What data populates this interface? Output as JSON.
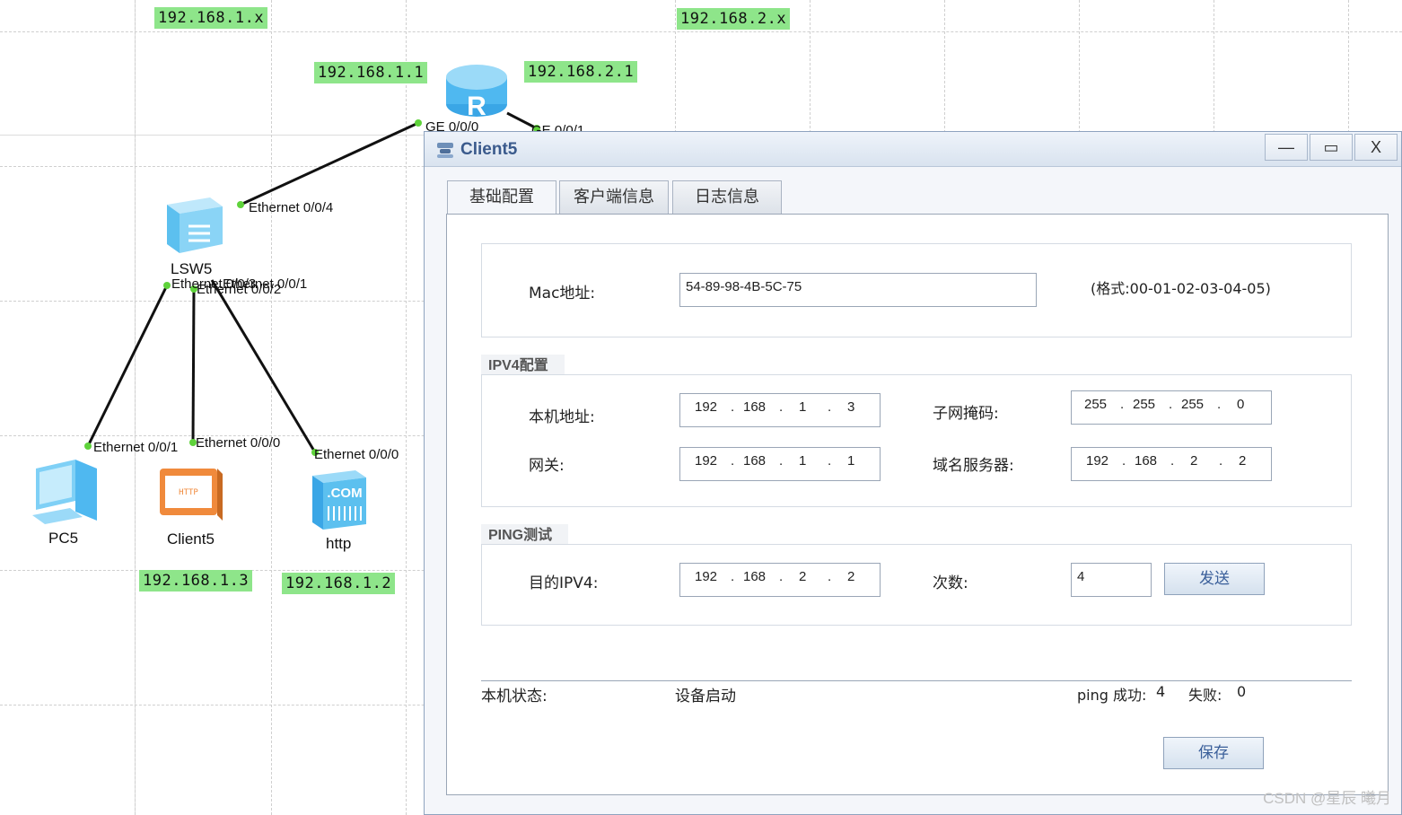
{
  "topology": {
    "subnet_labels": [
      "192.168.1.x",
      "192.168.2.x"
    ],
    "router_ip_left": "192.168.1.1",
    "router_ip_right": "192.168.2.1",
    "router_port_left": "GE 0/0/0",
    "router_port_right": "GE 0/0/1",
    "switch_name": "LSW5",
    "switch_port_up": "Ethernet 0/0/4",
    "switch_port_overlap_a": "Ethernet 0/0/2",
    "switch_port_overlap_b": "Ethernet 0/0/1",
    "switch_port_overlap_c": "Ethernet 0/0/3",
    "pc_port": "Ethernet 0/0/1",
    "client_port": "Ethernet 0/0/0",
    "http_port": "Ethernet 0/0/0",
    "pc_name": "PC5",
    "client_name": "Client5",
    "http_name": "http",
    "client_ip": "192.168.1.3",
    "http_ip": "192.168.1.2"
  },
  "window": {
    "title": "Client5",
    "buttons": {
      "minimize": "—",
      "maximize": "▭",
      "close": "X"
    },
    "tabs": [
      "基础配置",
      "客户端信息",
      "日志信息"
    ],
    "mac": {
      "label": "Mac地址:",
      "value": "54-89-98-4B-5C-75",
      "hint": "(格式:00-01-02-03-04-05)"
    },
    "ipv4": {
      "title": "IPV4配置",
      "local_label": "本机地址:",
      "local": [
        "192",
        "168",
        "1",
        "3"
      ],
      "mask_label": "子网掩码:",
      "mask": [
        "255",
        "255",
        "255",
        "0"
      ],
      "gateway_label": "网关:",
      "gateway": [
        "192",
        "168",
        "1",
        "1"
      ],
      "dns_label": "域名服务器:",
      "dns": [
        "192",
        "168",
        "2",
        "2"
      ]
    },
    "ping": {
      "title": "PING测试",
      "target_label": "目的IPV4:",
      "target": [
        "192",
        "168",
        "2",
        "2"
      ],
      "count_label": "次数:",
      "count": "4",
      "send_label": "发送"
    },
    "status": {
      "label": "本机状态:",
      "value": "设备启动",
      "success_label": "ping 成功:",
      "success": "4",
      "fail_label": "失败:",
      "fail": "0"
    },
    "save_label": "保存"
  },
  "watermark": "CSDN @星辰 曦月",
  "colors": {
    "ip_label_bg": "#8ee58a",
    "link": "#111111",
    "port_dot": "#5fd33b",
    "title_text": "#3a5a8c"
  }
}
